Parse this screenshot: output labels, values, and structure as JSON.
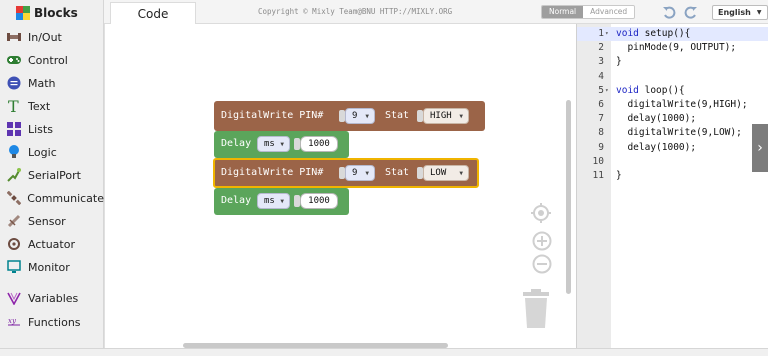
{
  "sidebar": {
    "title": "Blocks",
    "items": [
      {
        "label": "In/Out",
        "icon": "plug-icon"
      },
      {
        "label": "Control",
        "icon": "gamepad-icon"
      },
      {
        "label": "Math",
        "icon": "math-icon"
      },
      {
        "label": "Text",
        "icon": "text-icon"
      },
      {
        "label": "Lists",
        "icon": "lists-icon"
      },
      {
        "label": "Logic",
        "icon": "bulb-icon"
      },
      {
        "label": "SerialPort",
        "icon": "serial-icon"
      },
      {
        "label": "Communicate",
        "icon": "satellite-icon"
      },
      {
        "label": "Sensor",
        "icon": "sensor-icon"
      },
      {
        "label": "Actuator",
        "icon": "actuator-icon"
      },
      {
        "label": "Monitor",
        "icon": "monitor-icon"
      },
      {
        "label": "Variables",
        "icon": "variables-icon"
      },
      {
        "label": "Functions",
        "icon": "functions-icon"
      }
    ]
  },
  "topbar": {
    "tab_code": "Code",
    "copyright": "Copyright © Mixly Team@BNU HTTP://MIXLY.ORG",
    "mode_normal": "Normal",
    "mode_advanced": "Advanced",
    "language": "English"
  },
  "blocks": {
    "write1": {
      "label": "DigitalWrite PIN#",
      "pin": "9",
      "stat_label": "Stat",
      "stat": "HIGH"
    },
    "delay1": {
      "label": "Delay",
      "unit": "ms",
      "value": "1000"
    },
    "write2": {
      "label": "DigitalWrite PIN#",
      "pin": "9",
      "stat_label": "Stat",
      "stat": "LOW"
    },
    "delay2": {
      "label": "Delay",
      "unit": "ms",
      "value": "1000"
    }
  },
  "code": {
    "lines": [
      {
        "n": "1",
        "fold": "▾",
        "pre": "",
        "kw": "void",
        "rest": " setup(){"
      },
      {
        "n": "2",
        "fold": "",
        "pre": "  ",
        "kw": "",
        "rest": "pinMode(9, OUTPUT);"
      },
      {
        "n": "3",
        "fold": "",
        "pre": "",
        "kw": "",
        "rest": "}"
      },
      {
        "n": "4",
        "fold": "",
        "pre": "",
        "kw": "",
        "rest": ""
      },
      {
        "n": "5",
        "fold": "▾",
        "pre": "",
        "kw": "void",
        "rest": " loop(){"
      },
      {
        "n": "6",
        "fold": "",
        "pre": "  ",
        "kw": "",
        "rest": "digitalWrite(9,HIGH);"
      },
      {
        "n": "7",
        "fold": "",
        "pre": "  ",
        "kw": "",
        "rest": "delay(1000);"
      },
      {
        "n": "8",
        "fold": "",
        "pre": "  ",
        "kw": "",
        "rest": "digitalWrite(9,LOW);"
      },
      {
        "n": "9",
        "fold": "",
        "pre": "  ",
        "kw": "",
        "rest": "delay(1000);"
      },
      {
        "n": "10",
        "fold": "",
        "pre": "",
        "kw": "",
        "rest": ""
      },
      {
        "n": "11",
        "fold": "",
        "pre": "",
        "kw": "",
        "rest": "}"
      }
    ]
  },
  "colors": {
    "output_block": "#9b6448",
    "control_block": "#5ba55b",
    "selected_outline": "#f0b400",
    "keyword": "#1d25c4"
  }
}
